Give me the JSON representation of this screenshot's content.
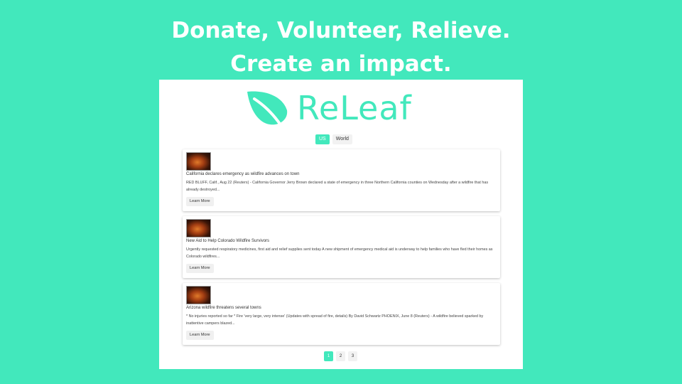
{
  "headline": {
    "line1": "Donate, Volunteer, Relieve.",
    "line2": "Create an impact."
  },
  "brand": {
    "name": "ReLeaf",
    "icon": "leaf-icon",
    "accent_color": "#42e8bc"
  },
  "tabs": [
    {
      "label": "US",
      "active": true
    },
    {
      "label": "World",
      "active": false
    }
  ],
  "articles": [
    {
      "title": "California declares emergency as wildfire advances on town",
      "body": "RED BLUFF, Calif., Aug 22 (Reuters) - California Governor Jerry Brown declared a state of emergency in three Northern California counties on Wednesday after a wildfire that has already destroyed...",
      "button": "Learn More"
    },
    {
      "title": "New Aid to Help Colorado Wildfire Survivors",
      "body": "Urgently requested respiratory medicines, first aid and relief supplies sent today A new shipment of emergency medical aid is underway to help families who have fled their homes as Colorado wildfires...",
      "button": "Learn More"
    },
    {
      "title": "Arizona wildfire threatens several towns",
      "body": "* No injuries reported so far * Fire 'very large, very intense' (Updates with spread of fire, details) By David Schwartz PHOENIX, June 8 (Reuters) - A wildfire believed sparked by inattentive campers blazed...",
      "button": "Learn More"
    }
  ],
  "pagination": {
    "pages": [
      "1",
      "2",
      "3"
    ],
    "current": "1"
  }
}
